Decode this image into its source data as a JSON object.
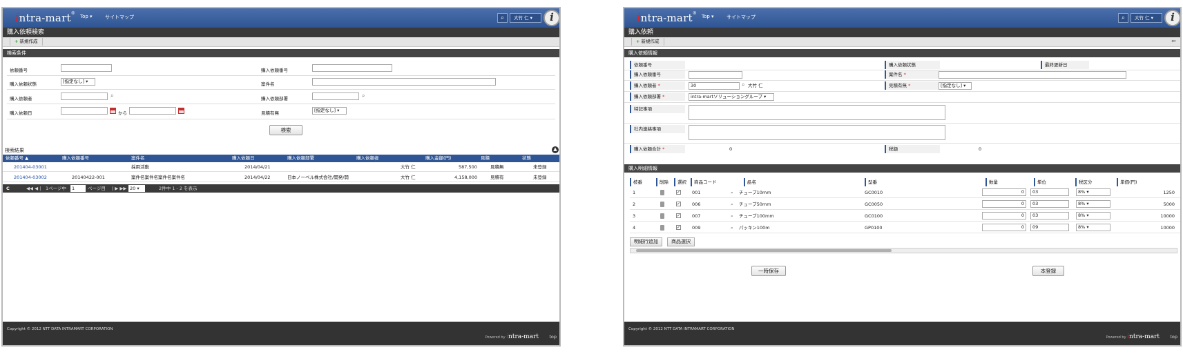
{
  "header": {
    "logo_i": "i",
    "logo_text": "ntra-mart",
    "logo_mark": "®",
    "nav_top": "Top ▾",
    "nav_sitemap": "サイトマップ",
    "search_icon": "⌕",
    "user_label": "大竹 仁 ▾",
    "badge": "i"
  },
  "left": {
    "page_title": "購入依頼検索",
    "new_button": "新規作成",
    "search_section": "検索条件",
    "fields": {
      "request_no_label": "依頼番号",
      "purchase_request_no_label": "購入依頼番号",
      "status_label": "購入依頼状態",
      "status_value": "[指定なし] ▾",
      "subject_label": "案件名",
      "requester_label": "購入依頼者",
      "dept_label": "購入依頼部署",
      "date_label": "購入依頼日",
      "date_from_to": "から",
      "estimate_label": "見積有無",
      "estimate_value": "[指定なし] ▾"
    },
    "search_button": "検索",
    "results_section": "検索結果",
    "collapse_icon": "▲",
    "columns": [
      "依頼番号 ▲",
      "購入依頼番号",
      "案件名",
      "購入依頼日",
      "購入依頼部署",
      "購入依頼者",
      "購入金額(円)",
      "見積",
      "状態"
    ],
    "rows": [
      [
        "201404-03001",
        "",
        "採用活動",
        "2014/04/21",
        "",
        "大竹 仁",
        "587,500",
        "見積無",
        "未登録"
      ],
      [
        "201404-03002",
        "20140422-001",
        "案件名案件名案件名案件名",
        "2014/04/22",
        "日本ノーベル株式会社/開発/開",
        "大竹 仁",
        "4,158,000",
        "見積有",
        "未登録"
      ]
    ],
    "pager": {
      "refresh": "C",
      "nav_prev": "◀◀ ◀ |",
      "page_prefix": "1ページ中",
      "page_value": "1",
      "page_suffix": "ページ目",
      "nav_next": "| ▶ ▶▶",
      "per_page": "20 ▾",
      "summary": "2件中 1 - 2 を表示"
    }
  },
  "right": {
    "page_title": "購入依頼",
    "new_button": "新規作成",
    "back_icon": "⇐",
    "info_section": "購入依頼情報",
    "fields": {
      "request_no_label": "依頼番号",
      "status_label": "購入依頼状態",
      "updated_label": "最終更新日",
      "purchase_no_label": "購入依頼番号",
      "subject_label": "案件名",
      "requester_label": "購入依頼者",
      "requester_code": "30",
      "requester_name": "大竹 仁",
      "estimate_label": "見積有無",
      "estimate_value": "[指定なし] ▾",
      "dept_label": "購入依頼部署",
      "dept_value": "intra-martソリューショングループ ▾",
      "special_label": "特記事項",
      "internal_label": "社内連絡事項",
      "total_label": "購入依頼合計",
      "total_value": "0",
      "tax_label": "税額",
      "tax_value": "0"
    },
    "detail_section": "購入明細情報",
    "detail_columns": [
      "枝番",
      "削除",
      "選択",
      "商品コード",
      "品名",
      "型番",
      "数量",
      "単位",
      "税区分",
      "単価(円)"
    ],
    "detail_rows": [
      {
        "no": "1",
        "code": "001",
        "name": "チューブ10mm",
        "model": "GC0010",
        "qty": "0",
        "unit": "03",
        "tax": "8%  ▾",
        "price": "1250"
      },
      {
        "no": "2",
        "code": "006",
        "name": "チューブ50mm",
        "model": "GC0050",
        "qty": "0",
        "unit": "03",
        "tax": "8%  ▾",
        "price": "5000"
      },
      {
        "no": "3",
        "code": "007",
        "name": "チューブ100mm",
        "model": "GC0100",
        "qty": "0",
        "unit": "03",
        "tax": "8%  ▾",
        "price": "10000"
      },
      {
        "no": "4",
        "code": "009",
        "name": "パッキン100m",
        "model": "GP0100",
        "qty": "0",
        "unit": "09",
        "tax": "8%  ▾",
        "price": "10000"
      }
    ],
    "add_row_button": "明細行追加",
    "product_select_button": "商品選択",
    "temp_save_button": "一時保存",
    "register_button": "本登録"
  },
  "footer": {
    "copyright": "Copyright © 2012 NTT DATA INTRAMART CORPORATION",
    "powered_by": "Powered by",
    "powered_logo_i": "i",
    "powered_logo_text": "ntra-mart",
    "top_link": "top"
  }
}
